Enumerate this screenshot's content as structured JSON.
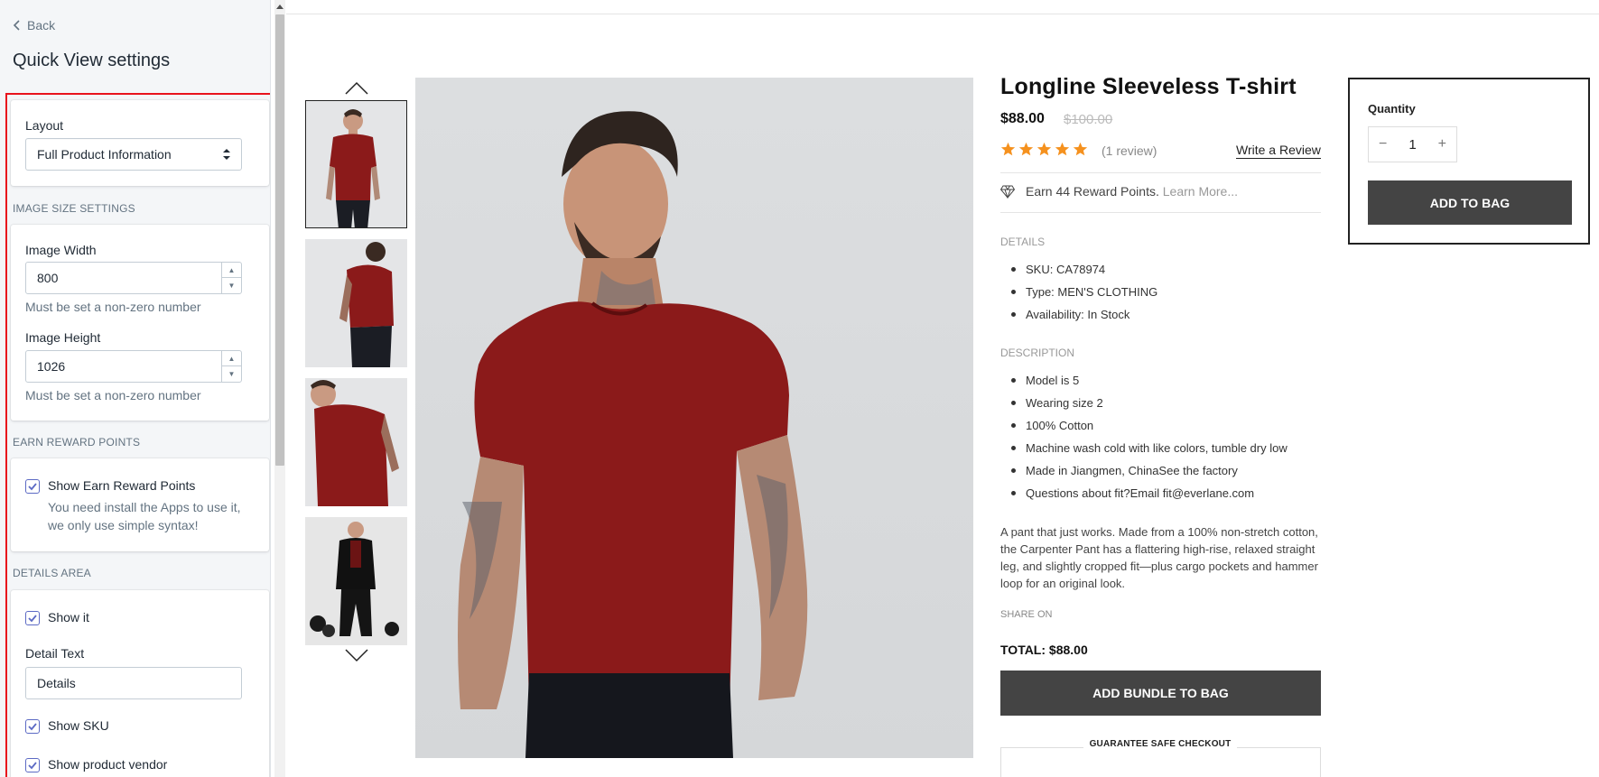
{
  "sidebar": {
    "back_label": "Back",
    "title": "Quick View settings",
    "layout": {
      "label": "Layout",
      "value": "Full Product Information"
    },
    "image_size": {
      "heading": "IMAGE SIZE SETTINGS",
      "width_label": "Image Width",
      "width_value": "800",
      "width_help": "Must be set a non-zero number",
      "height_label": "Image Height",
      "height_value": "1026",
      "height_help": "Must be set a non-zero number"
    },
    "reward": {
      "heading": "EARN REWARD POINTS",
      "checkbox_label": "Show Earn Reward Points",
      "help_line1": "You need install the Apps to use it,",
      "help_line2": "we only use simple syntax!"
    },
    "details": {
      "heading": "DETAILS AREA",
      "show_it": "Show it",
      "detail_text_label": "Detail Text",
      "detail_text_value": "Details",
      "show_sku": "Show SKU",
      "show_vendor": "Show product vendor"
    }
  },
  "product": {
    "title": "Longline Sleeveless T-shirt",
    "price": "$88.00",
    "old_price": "$100.00",
    "rating": 5,
    "review_count": "(1 review)",
    "write_review": "Write a Review",
    "reward_text": "Earn 44 Reward Points.",
    "reward_more": "Learn More...",
    "details_heading": "DETAILS",
    "details": {
      "sku": "SKU: CA78974",
      "type": "Type: MEN'S CLOTHING",
      "availability": "Availability: In Stock"
    },
    "description_heading": "DESCRIPTION",
    "description_items": [
      "Model is 5",
      "Wearing size 2",
      "100% Cotton",
      "Machine wash cold with like colors, tumble dry low",
      "Made in Jiangmen, ChinaSee the factory",
      "Questions about fit?Email fit@everlane.com"
    ],
    "description_text": "A pant that just works. Made from a 100% non-stretch cotton, the Carpenter Pant has a flattering high-rise, relaxed straight leg, and slightly cropped fit—plus cargo pockets and hammer loop for an original look.",
    "share_on": "SHARE ON",
    "total": "TOTAL: $88.00",
    "bundle_button": "ADD BUNDLE TO BAG",
    "guarantee": "GUARANTEE SAFE CHECKOUT"
  },
  "purchase": {
    "quantity_label": "Quantity",
    "quantity_value": "1",
    "add_button": "ADD TO BAG"
  },
  "colors": {
    "accent_check": "#5c6ac4",
    "highlight_frame": "#e8121c",
    "button_dark": "#444444",
    "star": "#f5911e",
    "shirt": "#8b1a1a"
  }
}
